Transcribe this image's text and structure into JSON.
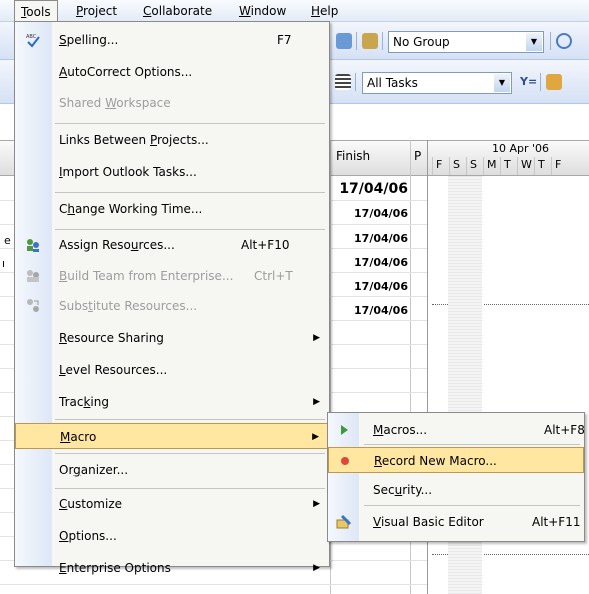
{
  "menubar": {
    "items": [
      {
        "label": "Tools",
        "accel": "T",
        "rest": "ools",
        "active": true
      },
      {
        "label": "Project",
        "accel": "P",
        "rest": "roject"
      },
      {
        "label": "Collaborate",
        "accel": "C",
        "rest": "ollaborate"
      },
      {
        "label": "Window",
        "accel": "W",
        "rest": "indow"
      },
      {
        "label": "Help",
        "accel": "H",
        "rest": "elp"
      }
    ]
  },
  "toolbar": {
    "group_combo": "No Group",
    "filter_combo": "All Tasks",
    "filter_icon_label": "Y="
  },
  "grid": {
    "finish_header": "Finish",
    "pred_header": "P",
    "week_label": "10 Apr '06",
    "day_letters": [
      "F",
      "S",
      "S",
      "M",
      "T",
      "W",
      "T",
      "F"
    ],
    "finish_dates": [
      "17/04/06",
      "17/04/06",
      "17/04/06",
      "17/04/06",
      "17/04/06",
      "17/04/06"
    ]
  },
  "tools_menu": {
    "items": [
      {
        "pre": "",
        "acc": "S",
        "post": "pelling...",
        "shortcut": "F7",
        "icon": "spelling-icon"
      },
      {
        "pre": "",
        "acc": "A",
        "post": "utoCorrect Options...",
        "shortcut": ""
      },
      {
        "pre": "Shared ",
        "acc": "W",
        "post": "orkspace",
        "shortcut": "",
        "disabled": true
      },
      {
        "pre": "Links Between ",
        "acc": "P",
        "post": "rojects...",
        "shortcut": ""
      },
      {
        "pre": "",
        "acc": "I",
        "post": "mport Outlook Tasks...",
        "shortcut": ""
      },
      {
        "pre": "C",
        "acc": "h",
        "post": "ange Working Time...",
        "shortcut": ""
      },
      {
        "pre": "Assign Reso",
        "acc": "u",
        "post": "rces...",
        "shortcut": "Alt+F10",
        "icon": "assign-resources-icon"
      },
      {
        "pre": "",
        "acc": "B",
        "post": "uild Team from Enterprise...",
        "shortcut": "Ctrl+T",
        "disabled": true,
        "icon": "build-team-icon"
      },
      {
        "pre": "Subs",
        "acc": "t",
        "post": "itute Resources...",
        "shortcut": "",
        "disabled": true,
        "icon": "substitute-resources-icon"
      },
      {
        "pre": "",
        "acc": "R",
        "post": "esource Sharing",
        "shortcut": "",
        "submenu": true
      },
      {
        "pre": "",
        "acc": "L",
        "post": "evel Resources...",
        "shortcut": ""
      },
      {
        "pre": "Trac",
        "acc": "k",
        "post": "ing",
        "shortcut": "",
        "submenu": true
      },
      {
        "pre": "",
        "acc": "M",
        "post": "acro",
        "shortcut": "",
        "submenu": true,
        "highlighted": true
      },
      {
        "pre": "Or",
        "acc": "g",
        "post": "anizer...",
        "shortcut": ""
      },
      {
        "pre": "",
        "acc": "C",
        "post": "ustomize",
        "shortcut": "",
        "submenu": true
      },
      {
        "pre": "",
        "acc": "O",
        "post": "ptions...",
        "shortcut": ""
      },
      {
        "pre": "",
        "acc": "E",
        "post": "nterprise Options",
        "shortcut": "",
        "submenu": true
      }
    ]
  },
  "macro_submenu": {
    "items": [
      {
        "pre": "",
        "acc": "M",
        "post": "acros...",
        "shortcut": "Alt+F8",
        "icon": "play-macro-icon"
      },
      {
        "pre": "",
        "acc": "R",
        "post": "ecord New Macro...",
        "shortcut": "",
        "icon": "record-macro-icon",
        "highlighted": true
      },
      {
        "pre": "Sec",
        "acc": "u",
        "post": "rity...",
        "shortcut": ""
      },
      {
        "pre": "",
        "acc": "V",
        "post": "isual Basic Editor",
        "shortcut": "Alt+F11",
        "icon": "visual-basic-editor-icon"
      }
    ]
  },
  "colors": {
    "highlight": "#ffe7a2",
    "highlight_border": "#c1974b",
    "menu_bg": "#f6f6f3",
    "gutter": "#dde7f6"
  }
}
